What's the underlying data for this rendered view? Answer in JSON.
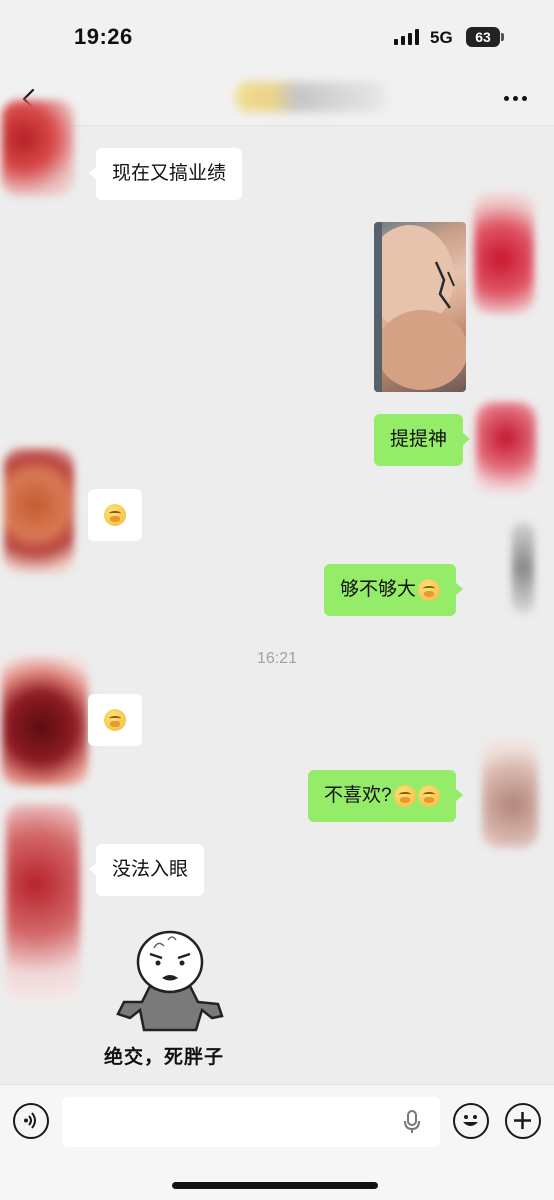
{
  "status_bar": {
    "time": "19:26",
    "network": "5G",
    "battery": "63"
  },
  "nav": {
    "back_icon": "chevron-left-icon",
    "more_icon": "ellipsis-icon"
  },
  "messages": {
    "m1": "现在又搞业绩",
    "m3": "提提神",
    "m5": "够不够大",
    "timestamp": "16:21",
    "m7": "不喜欢?",
    "m8": "没法入眼",
    "sticker_caption": "绝交，死胖子"
  },
  "input": {
    "placeholder": "",
    "value": ""
  },
  "icons": {
    "voice": "voice-icon",
    "mic": "microphone-icon",
    "emoji": "smile-icon",
    "plus": "plus-icon"
  },
  "colors": {
    "sent_bubble": "#95ec69",
    "received_bubble": "#ffffff",
    "background": "#ededed"
  }
}
